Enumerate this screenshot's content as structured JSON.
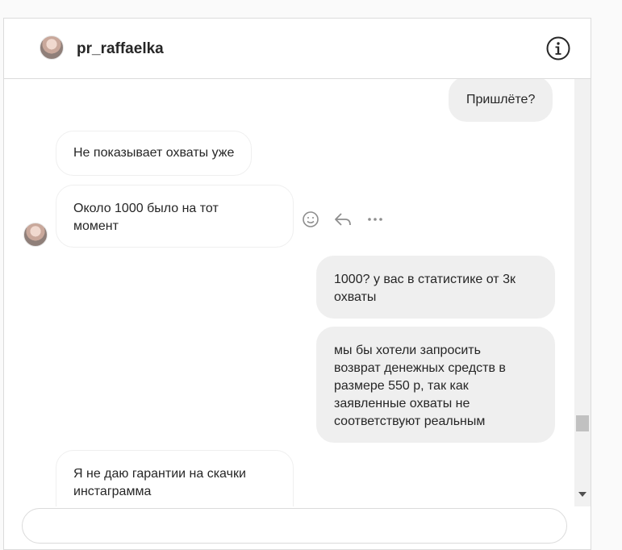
{
  "header": {
    "username": "pr_raffaelka",
    "info_icon": "info-circle-icon"
  },
  "messages": [
    {
      "direction": "out",
      "text": "Пришлёте?"
    },
    {
      "direction": "in",
      "text": "Не показывает охваты уже"
    },
    {
      "direction": "in",
      "lines": [
        "Около 1000 было на тот",
        "момент"
      ]
    },
    {
      "direction": "out",
      "lines": [
        "1000? у вас в статистике от 3к",
        "охваты"
      ]
    },
    {
      "direction": "out",
      "lines": [
        "мы бы хотели запросить",
        "возврат денежных средств в",
        "размере 550 р, так как",
        "заявленные охваты не",
        "соответствуют реальным"
      ]
    },
    {
      "direction": "in",
      "lines": [
        "Я не даю гарантии на скачки",
        "инстаграмма"
      ]
    }
  ],
  "message_actions": {
    "react_icon": "smiley-icon",
    "reply_icon": "reply-arrow-icon",
    "more_icon": "more-dots-icon"
  },
  "colors": {
    "incoming_bubble": "#ffffff",
    "outgoing_bubble": "#efefef",
    "border": "#dbdbdb"
  }
}
